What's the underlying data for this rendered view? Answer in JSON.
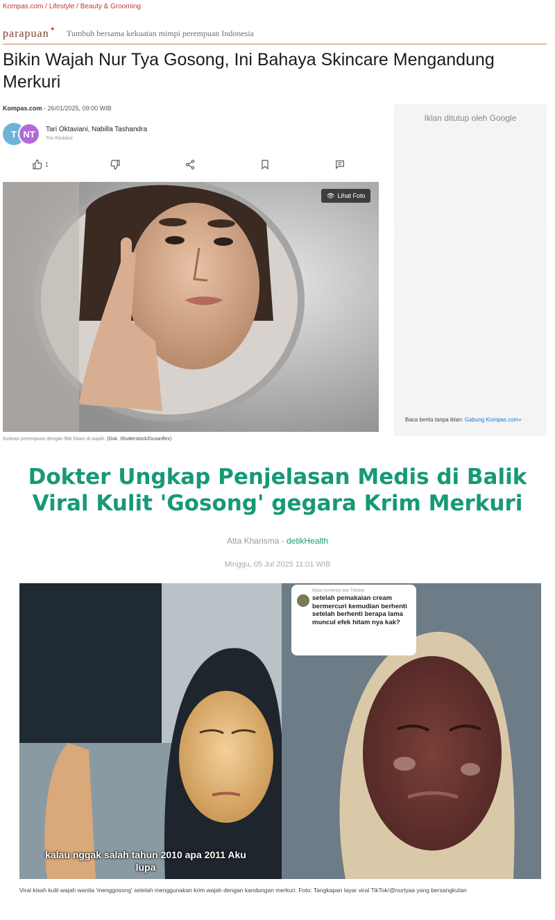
{
  "breadcrumb": {
    "site": "Kompas.com",
    "section": "Lifestyle",
    "subsection": "Beauty & Grooming"
  },
  "brand": {
    "logo": "parapuan",
    "tagline": "Tumbuh bersama kekuatan mimpi perempuan Indonesia"
  },
  "article1": {
    "headline": "Bikin Wajah Nur Tya Gosong, Ini Bahaya Skincare Mengandung Merkuri",
    "source": "Kompas.com",
    "date": " - 26/01/2025, 09:00 WIB",
    "avatars": [
      "T",
      "NT"
    ],
    "authors": "Tari Oktaviani, Nabilla Tashandra",
    "author_role": "Tim Redaksi",
    "like_count": "1",
    "photo_button": "Lihat Foto",
    "photo_caption": "Ilustrasi perempuan dengan flek hitam di wajah.",
    "photo_credit": "(Dok. Shutterstock/Dusanflex)"
  },
  "ad": {
    "label": "Iklan ditutup oleh Google",
    "footer_text": "Baca berita tanpa iklan: ",
    "footer_link": "Gabung Kompas.com+"
  },
  "article2": {
    "headline": "Dokter Ungkap Penjelasan Medis di Balik Viral Kulit 'Gosong' gegara Krim Merkuri",
    "author": "Atta Kharisma",
    "separator": " - ",
    "outlet": "detikHealth",
    "date": "Minggu, 05 Jul 2025 11:01 WIB",
    "comment_user": "Balas komentar dari Tiktoker",
    "comment_text": "setelah pemakaian cream bermercuri kemudian berhenti setelah berhenti berapa lama muncul efek hitam nya kak?",
    "video_subtitle": "kalau nggak salah tahun 2010 apa 2011 Aku lupa",
    "caption": "Viral kisah kulit wajah wanita 'menggosong' setelah menggunakan krim wajah dengan kandungan merkuri. Foto: Tangkapan layar viral TikTok/@nurtyaa yang bersangkutan"
  },
  "colors": {
    "brand_accent": "#c0392b",
    "detik_green": "#169976",
    "ad_bg": "#f4f4f4"
  }
}
